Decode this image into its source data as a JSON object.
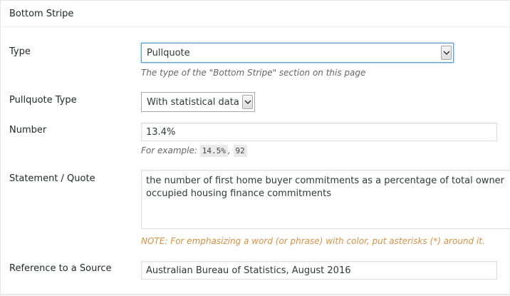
{
  "panel": {
    "title": "Bottom Stripe"
  },
  "type_field": {
    "label": "Type",
    "value": "Pullquote",
    "description": "The type of the \"Bottom Stripe\" section on this page"
  },
  "pullquote_type_field": {
    "label": "Pullquote Type",
    "value": "With statistical data"
  },
  "number_field": {
    "label": "Number",
    "value": "13.4%",
    "description_prefix": "For example:",
    "example_1": "14.5%",
    "separator": ",",
    "example_2": "92"
  },
  "statement_field": {
    "label": "Statement / Quote",
    "value": "the number of first home buyer commitments as a percentage of total owner occupied housing finance commitments",
    "note": "NOTE: For emphasizing a word (or phrase) with color, put asterisks (*) around it."
  },
  "source_field": {
    "label": "Reference to a Source",
    "value": "Australian Bureau of Statistics, August 2016"
  },
  "colors": {
    "focus_border": "#5b9dd9",
    "note_text": "#d39143",
    "panel_bg": "#ffffff",
    "page_bg": "#f1f1f1"
  },
  "icons": {
    "dropdown": "chevron-down-icon"
  }
}
